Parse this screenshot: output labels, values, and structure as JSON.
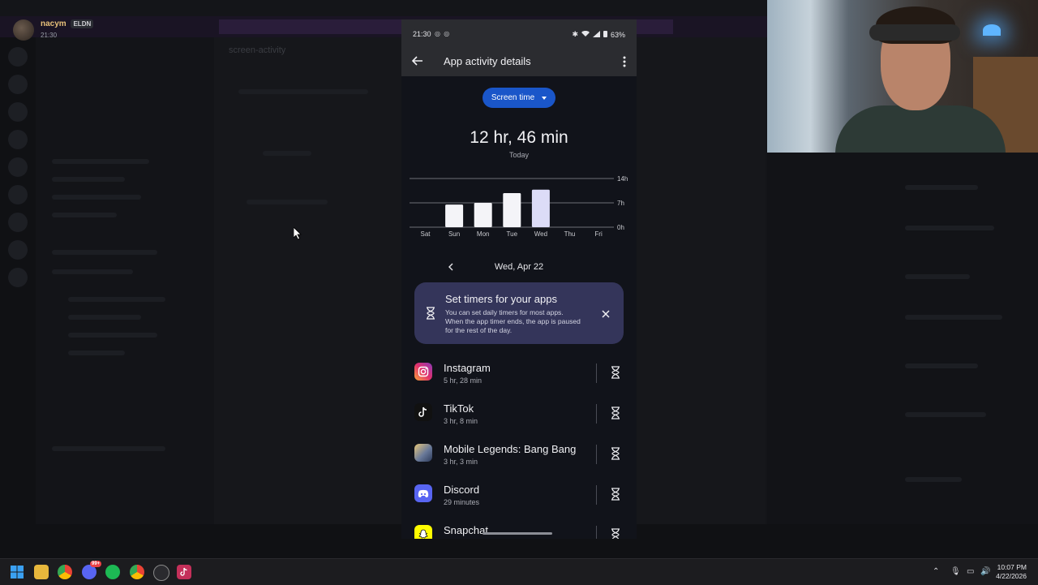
{
  "stream_overlay": {
    "username": "nacym",
    "badge": "ELDN",
    "time": "21:30"
  },
  "background": {
    "channel_header": "screen-activity"
  },
  "phone": {
    "status_bar": {
      "time": "21:30",
      "battery": "63%"
    },
    "app_bar": {
      "title": "App activity details",
      "back_icon": "back-arrow-icon",
      "more_icon": "more-vert-icon"
    },
    "metric_selector": {
      "label": "Screen time"
    },
    "summary": {
      "total": "12 hr, 46 min",
      "period": "Today"
    },
    "chart_data": {
      "type": "bar",
      "categories": [
        "Sat",
        "Sun",
        "Mon",
        "Tue",
        "Wed",
        "Thu",
        "Fri"
      ],
      "values": [
        0,
        6.5,
        7.0,
        9.8,
        10.8,
        0,
        0
      ],
      "highlight_index": 4,
      "y_ticks": [
        "14h",
        "7h",
        "0h"
      ],
      "ylim": [
        0,
        14
      ],
      "grid": true
    },
    "date_nav": {
      "label": "Wed, Apr 22"
    },
    "tip_card": {
      "title": "Set timers for your apps",
      "text": "You can set daily timers for most apps. When the app timer ends, the app is paused for the rest of the day."
    },
    "apps": [
      {
        "name": "Instagram",
        "time": "5 hr, 28 min",
        "icon": "instagram-icon",
        "color": "#d6297a"
      },
      {
        "name": "TikTok",
        "time": "3 hr, 8 min",
        "icon": "tiktok-icon",
        "color": "#111111"
      },
      {
        "name": "Mobile Legends: Bang Bang",
        "time": "3 hr, 3 min",
        "icon": "mobile-legends-icon",
        "color": "#6a7a9a"
      },
      {
        "name": "Discord",
        "time": "29 minutes",
        "icon": "discord-icon",
        "color": "#5865f2"
      },
      {
        "name": "Snapchat",
        "time": "",
        "icon": "snapchat-icon",
        "color": "#fffc00"
      }
    ]
  },
  "taskbar": {
    "clock_time": "10:07 PM",
    "clock_date": "4/22/2026",
    "discord_badge": "99+"
  }
}
